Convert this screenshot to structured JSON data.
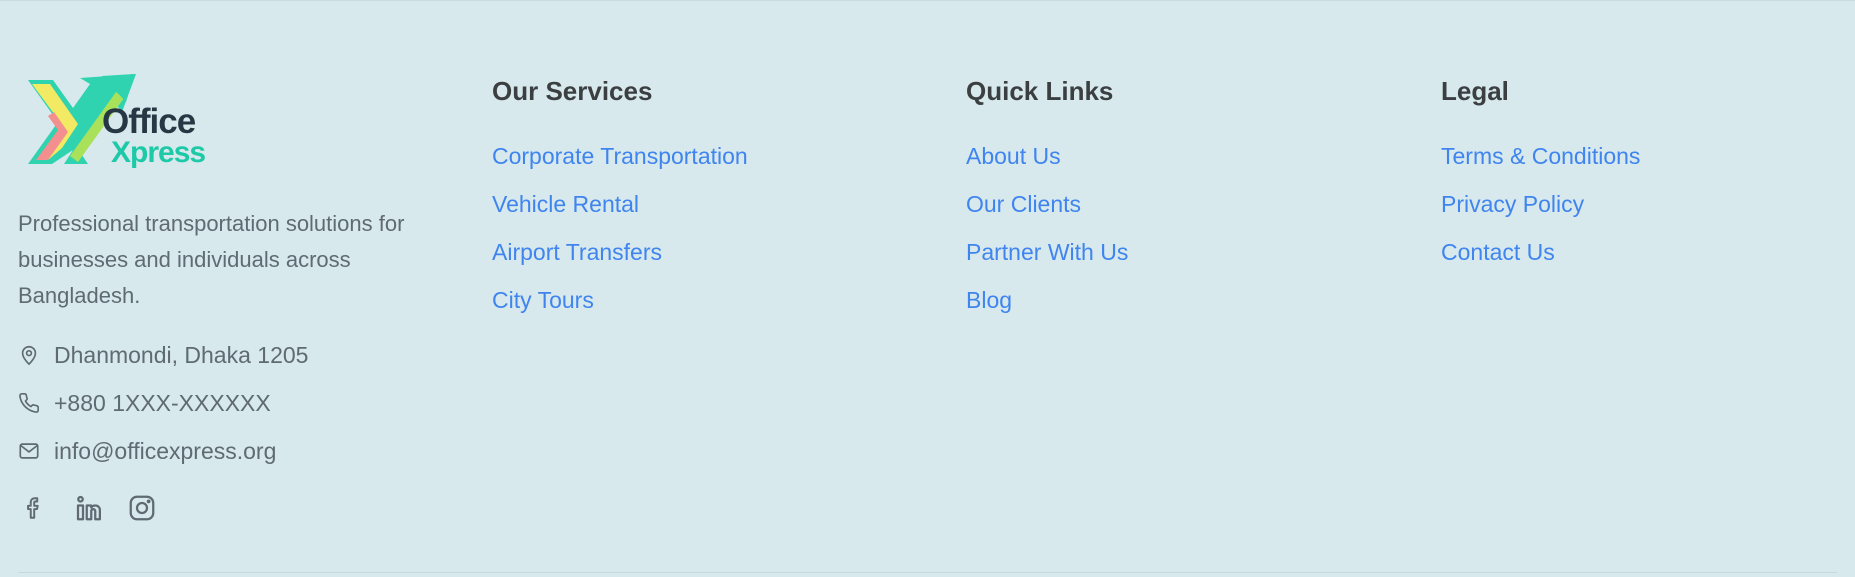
{
  "brand": {
    "logo_line1": "Office",
    "logo_line2": "Xpress",
    "description": "Professional transportation solutions for businesses and individuals across Bangladesh.",
    "address": "Dhanmondi, Dhaka 1205",
    "phone": "+880 1XXX-XXXXXX",
    "email": "info@officexpress.org",
    "social": [
      "facebook-icon",
      "linkedin-icon",
      "instagram-icon"
    ]
  },
  "services": {
    "heading": "Our Services",
    "items": [
      "Corporate Transportation",
      "Vehicle Rental",
      "Airport Transfers",
      "City Tours"
    ]
  },
  "quick_links": {
    "heading": "Quick Links",
    "items": [
      "About Us",
      "Our Clients",
      "Partner With Us",
      "Blog"
    ]
  },
  "legal": {
    "heading": "Legal",
    "items": [
      "Terms & Conditions",
      "Privacy Policy",
      "Contact Us"
    ]
  },
  "colors": {
    "background": "#d7e9ec",
    "link": "#3f84ef",
    "heading": "#3b3f42",
    "body_text": "#5f6a72",
    "logo_dark": "#263844",
    "logo_accent": "#1ec9a7"
  }
}
